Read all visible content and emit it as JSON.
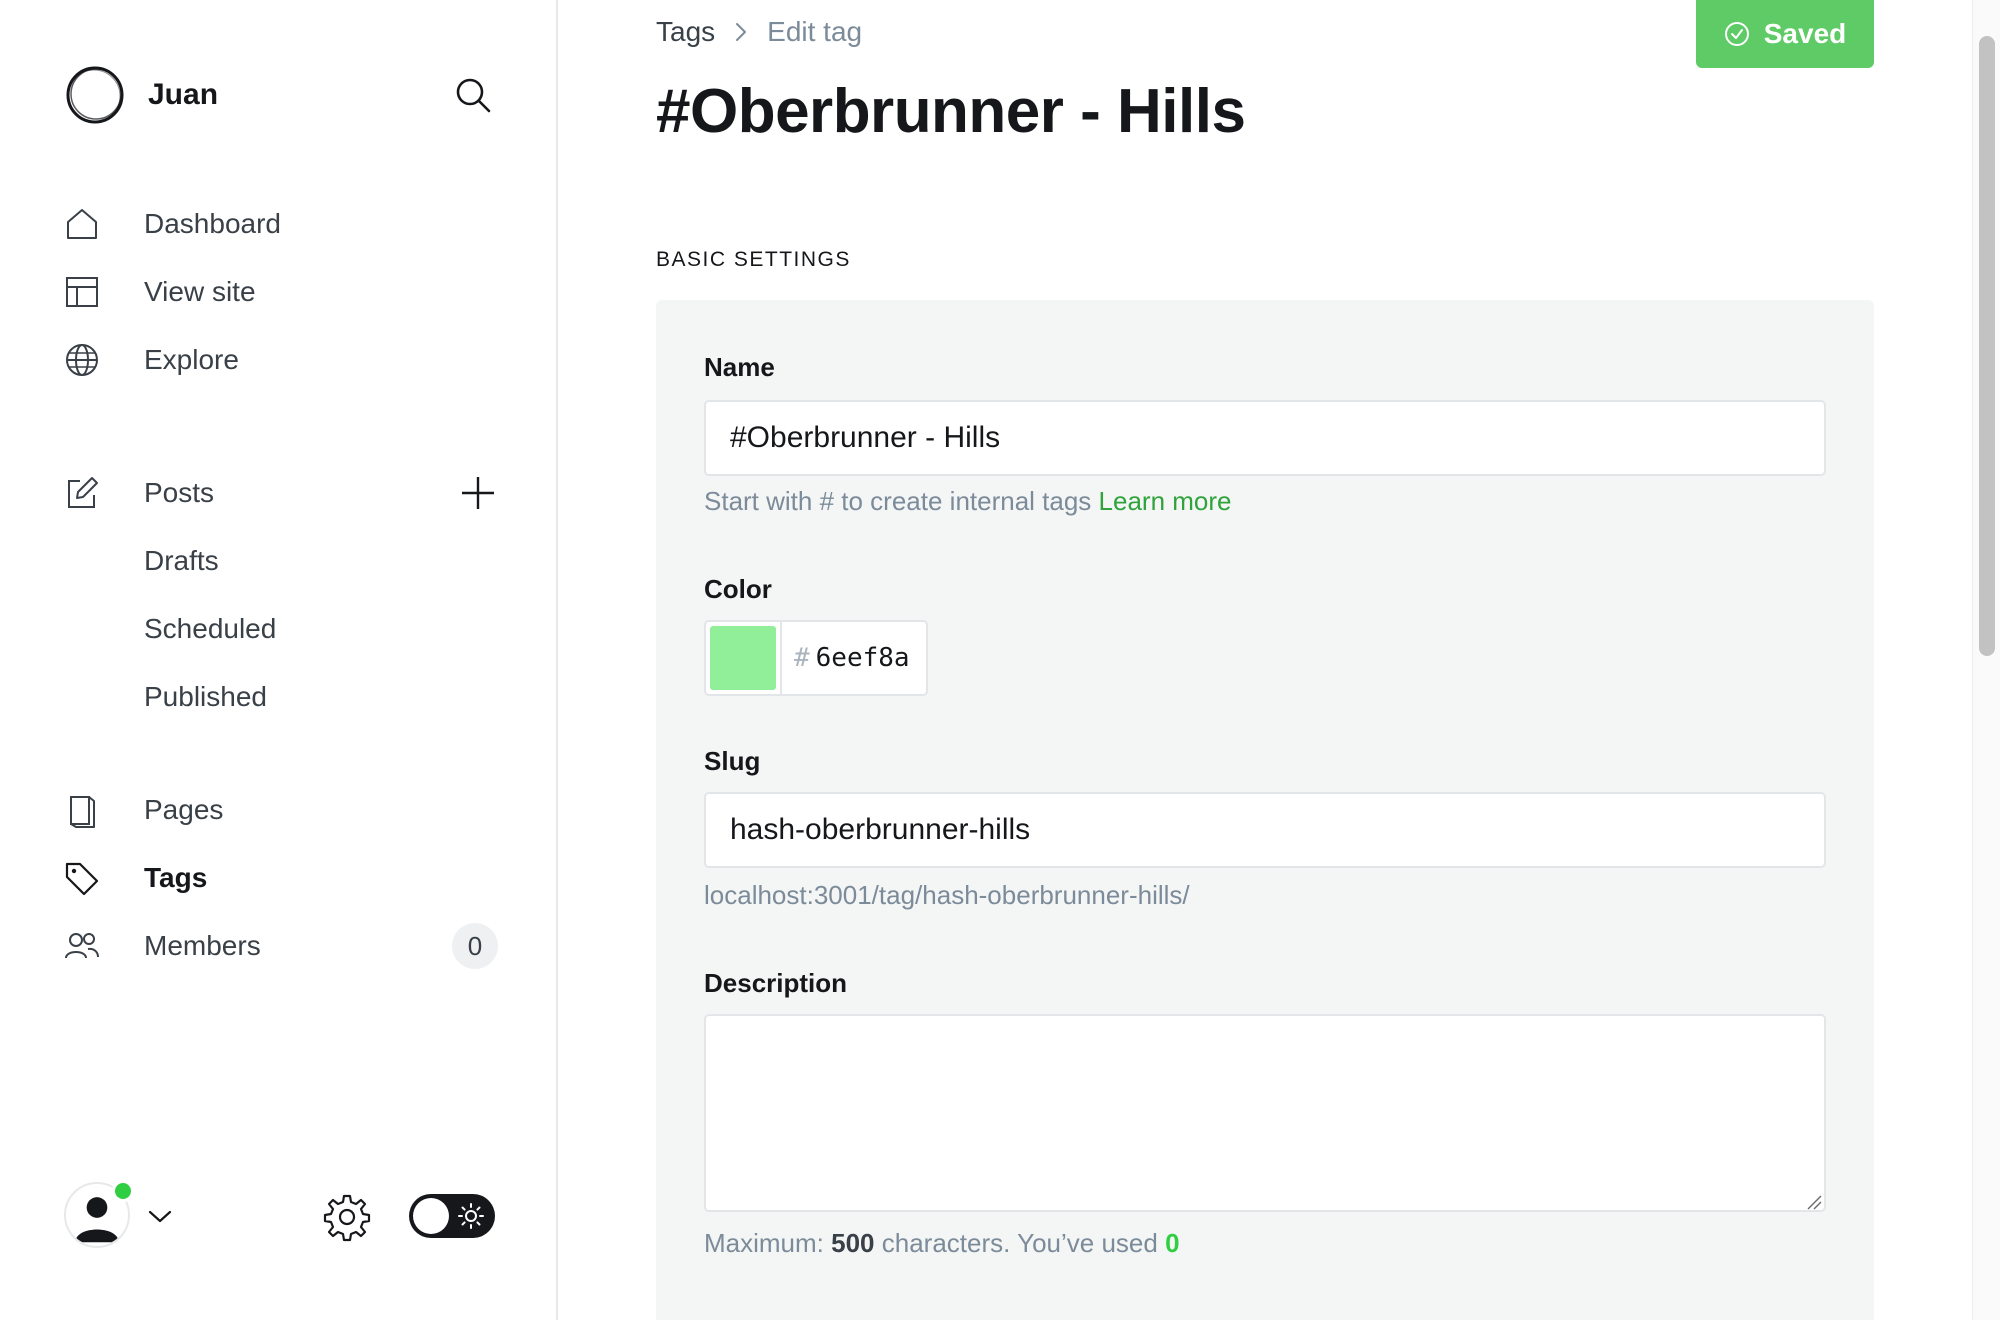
{
  "sidebar": {
    "site_name": "Juan",
    "nav": {
      "dashboard": "Dashboard",
      "view_site": "View site",
      "explore": "Explore",
      "posts": "Posts",
      "drafts": "Drafts",
      "scheduled": "Scheduled",
      "published": "Published",
      "pages": "Pages",
      "tags": "Tags",
      "members": "Members"
    },
    "members_count": "0",
    "icons": {
      "search": "search-icon",
      "dashboard": "home-icon",
      "view_site": "layout-icon",
      "explore": "globe-icon",
      "posts": "pencil-square-icon",
      "add_post": "plus-icon",
      "pages": "page-icon",
      "tags": "tag-icon",
      "members": "users-icon",
      "settings": "gear-icon",
      "theme": "sun-icon"
    }
  },
  "header": {
    "breadcrumb_parent": "Tags",
    "breadcrumb_current": "Edit tag",
    "title": "#Oberbrunner - Hills",
    "save_label": "Saved"
  },
  "form": {
    "section_title": "BASIC SETTINGS",
    "name": {
      "label": "Name",
      "value": "#Oberbrunner - Hills",
      "hint": "Start with # to create internal tags",
      "hint_link": "Learn more"
    },
    "color": {
      "label": "Color",
      "hash": "#",
      "value": "6eef8a"
    },
    "slug": {
      "label": "Slug",
      "value": "hash-oberbrunner-hills",
      "url": "localhost:3001/tag/hash-oberbrunner-hills/"
    },
    "description": {
      "label": "Description",
      "value": "",
      "counter_prefix": "Maximum:",
      "max": "500",
      "counter_middle": "characters. You’ve used",
      "used": "0"
    }
  },
  "colors": {
    "accent": "#30cf43",
    "saved_button": "#5fcb66",
    "tag_color": "#90ef98"
  }
}
